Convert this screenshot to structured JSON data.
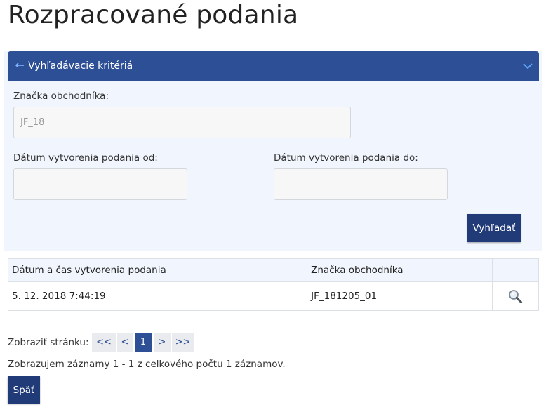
{
  "page": {
    "title": "Rozpracované podania"
  },
  "search_panel": {
    "header_label": "Vyhľadávacie kritériá",
    "merchant_mark_label": "Značka obchodníka:",
    "merchant_mark_value": "JF_18",
    "date_from_label": "Dátum vytvorenia podania od:",
    "date_from_value": "",
    "date_to_label": "Dátum vytvorenia podania do:",
    "date_to_value": "",
    "search_button_label": "Vyhľadať"
  },
  "results": {
    "columns": [
      "Dátum a čas vytvorenia podania",
      "Značka obchodníka",
      ""
    ],
    "rows": [
      {
        "created": "5. 12. 2018 7:44:19",
        "merchant_mark": "JF_181205_01",
        "action_icon": "magnifier-icon"
      }
    ]
  },
  "pager": {
    "label": "Zobraziť stránku:",
    "first": "<<",
    "prev": "<",
    "current": "1",
    "next": ">",
    "last": ">>"
  },
  "summary_text": "Zobrazujem záznamy 1 - 1 z celkového počtu 1 záznamov.",
  "back_button_label": "Späť",
  "colors": {
    "header_bg": "#2d4f96",
    "button_bg": "#213a78",
    "panel_bg": "#f1f5fd"
  }
}
